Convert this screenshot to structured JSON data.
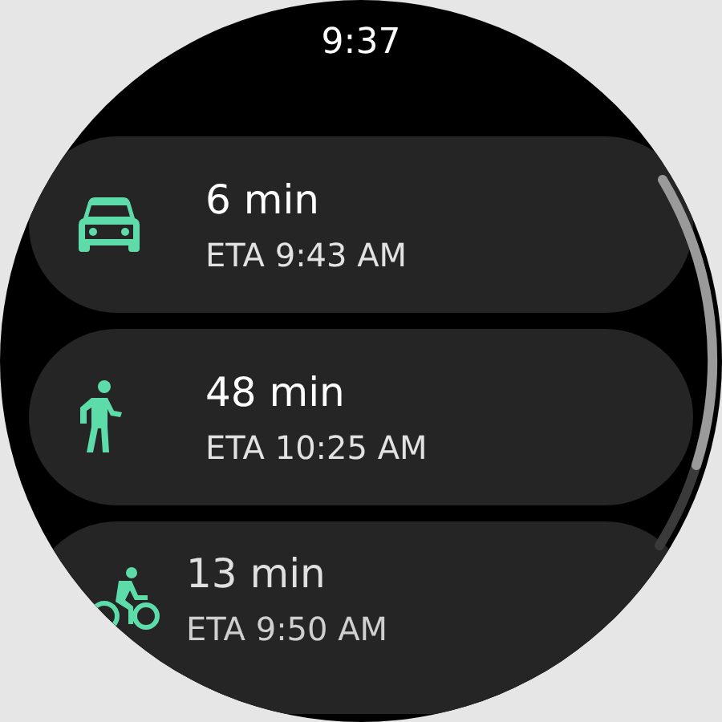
{
  "status_bar": {
    "time": "9:37"
  },
  "routes": [
    {
      "kind": "car",
      "duration": "6 min",
      "eta": "ETA 9:43 AM"
    },
    {
      "kind": "walk",
      "duration": "48 min",
      "eta": "ETA 10:25 AM"
    },
    {
      "kind": "bike",
      "duration": "13 min",
      "eta": "ETA 9:50 AM"
    }
  ]
}
